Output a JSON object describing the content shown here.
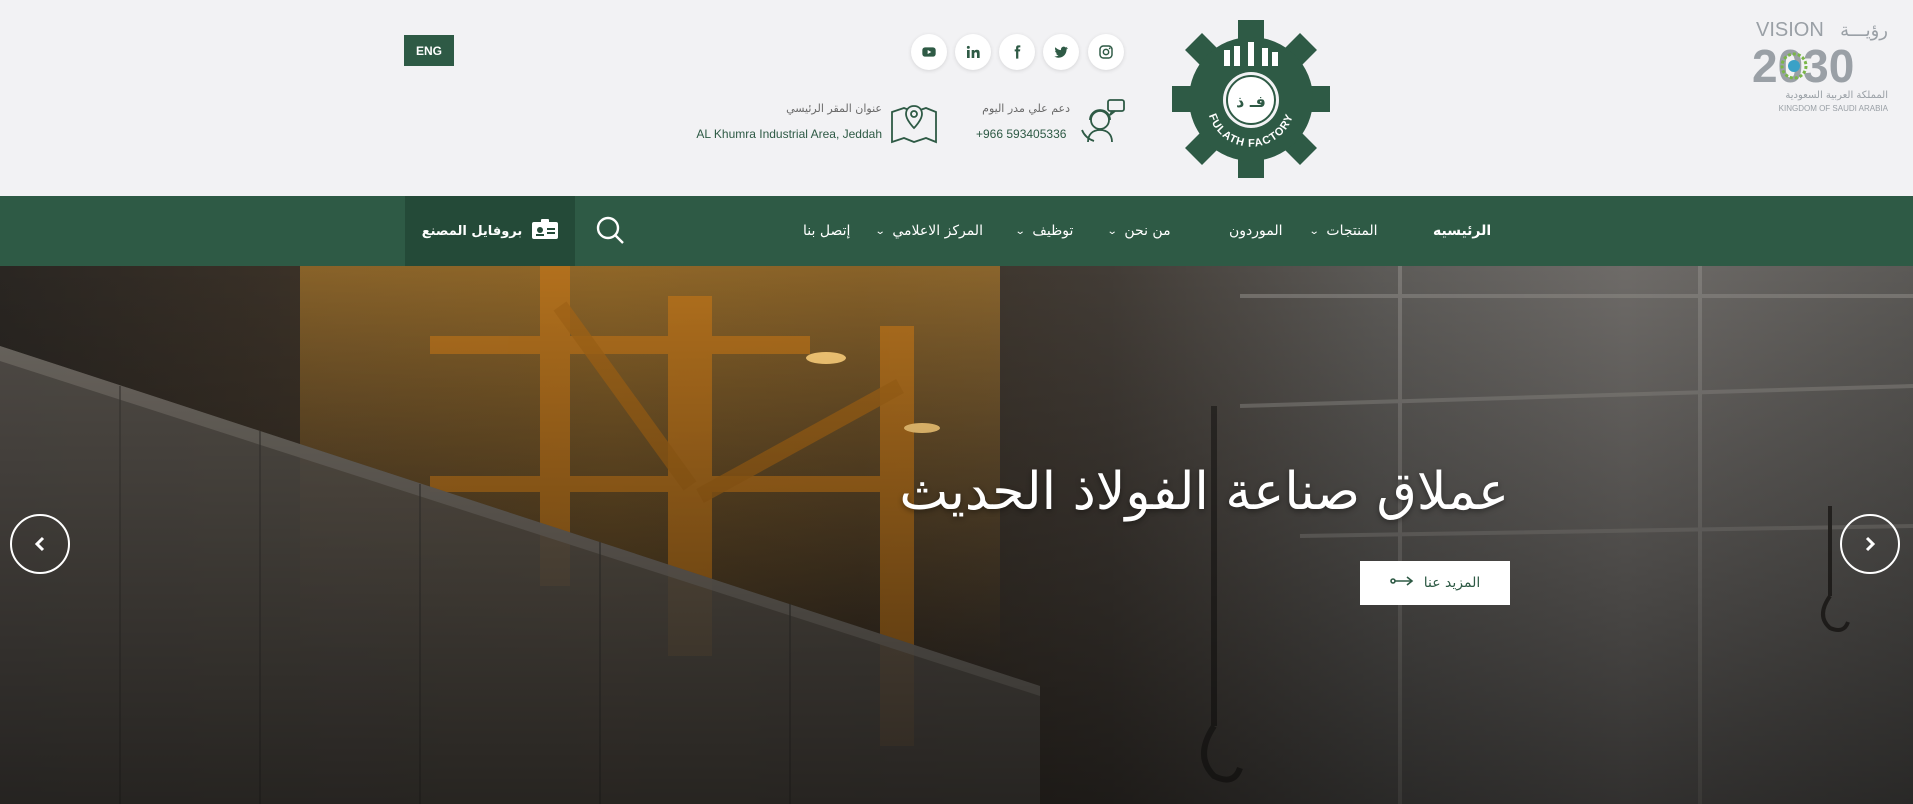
{
  "header": {
    "vision": {
      "vision_text": "VISION",
      "arabic_vision": "رؤيـــة",
      "year": "2030",
      "kingdom_ar": "المملكة العربية السعودية",
      "kingdom_en": "KINGDOM OF SAUDI ARABIA"
    },
    "logo": {
      "arabic": "فـ ذ",
      "english": "FULATH FACTORY"
    },
    "support": {
      "label": "دعم علي مدر اليوم",
      "value": "+966 593405336"
    },
    "address": {
      "label": "عنوان المقر الرئيسي",
      "value": "AL Khumra Industrial Area, Jeddah"
    },
    "language_button": "ENG",
    "social": [
      "instagram-icon",
      "twitter-icon",
      "facebook-icon",
      "linkedin-icon",
      "youtube-icon"
    ]
  },
  "nav": {
    "items": [
      {
        "label": "الرئيسيه",
        "dropdown": false
      },
      {
        "label": "المنتجات",
        "dropdown": true
      },
      {
        "label": "الموردون",
        "dropdown": false
      },
      {
        "label": "من نحن",
        "dropdown": true
      },
      {
        "label": "توظيف",
        "dropdown": true
      },
      {
        "label": "المركز الاعلامي",
        "dropdown": true
      },
      {
        "label": "إتصل بنا",
        "dropdown": false
      }
    ],
    "profile_button": "بروفايل المصنع"
  },
  "hero": {
    "title": "عملاق صناعة الفولاذ الحديث",
    "button": "المزيد عنا"
  },
  "colors": {
    "brand_green": "#2e5a45",
    "background": "#f2f2f4",
    "white": "#ffffff"
  }
}
